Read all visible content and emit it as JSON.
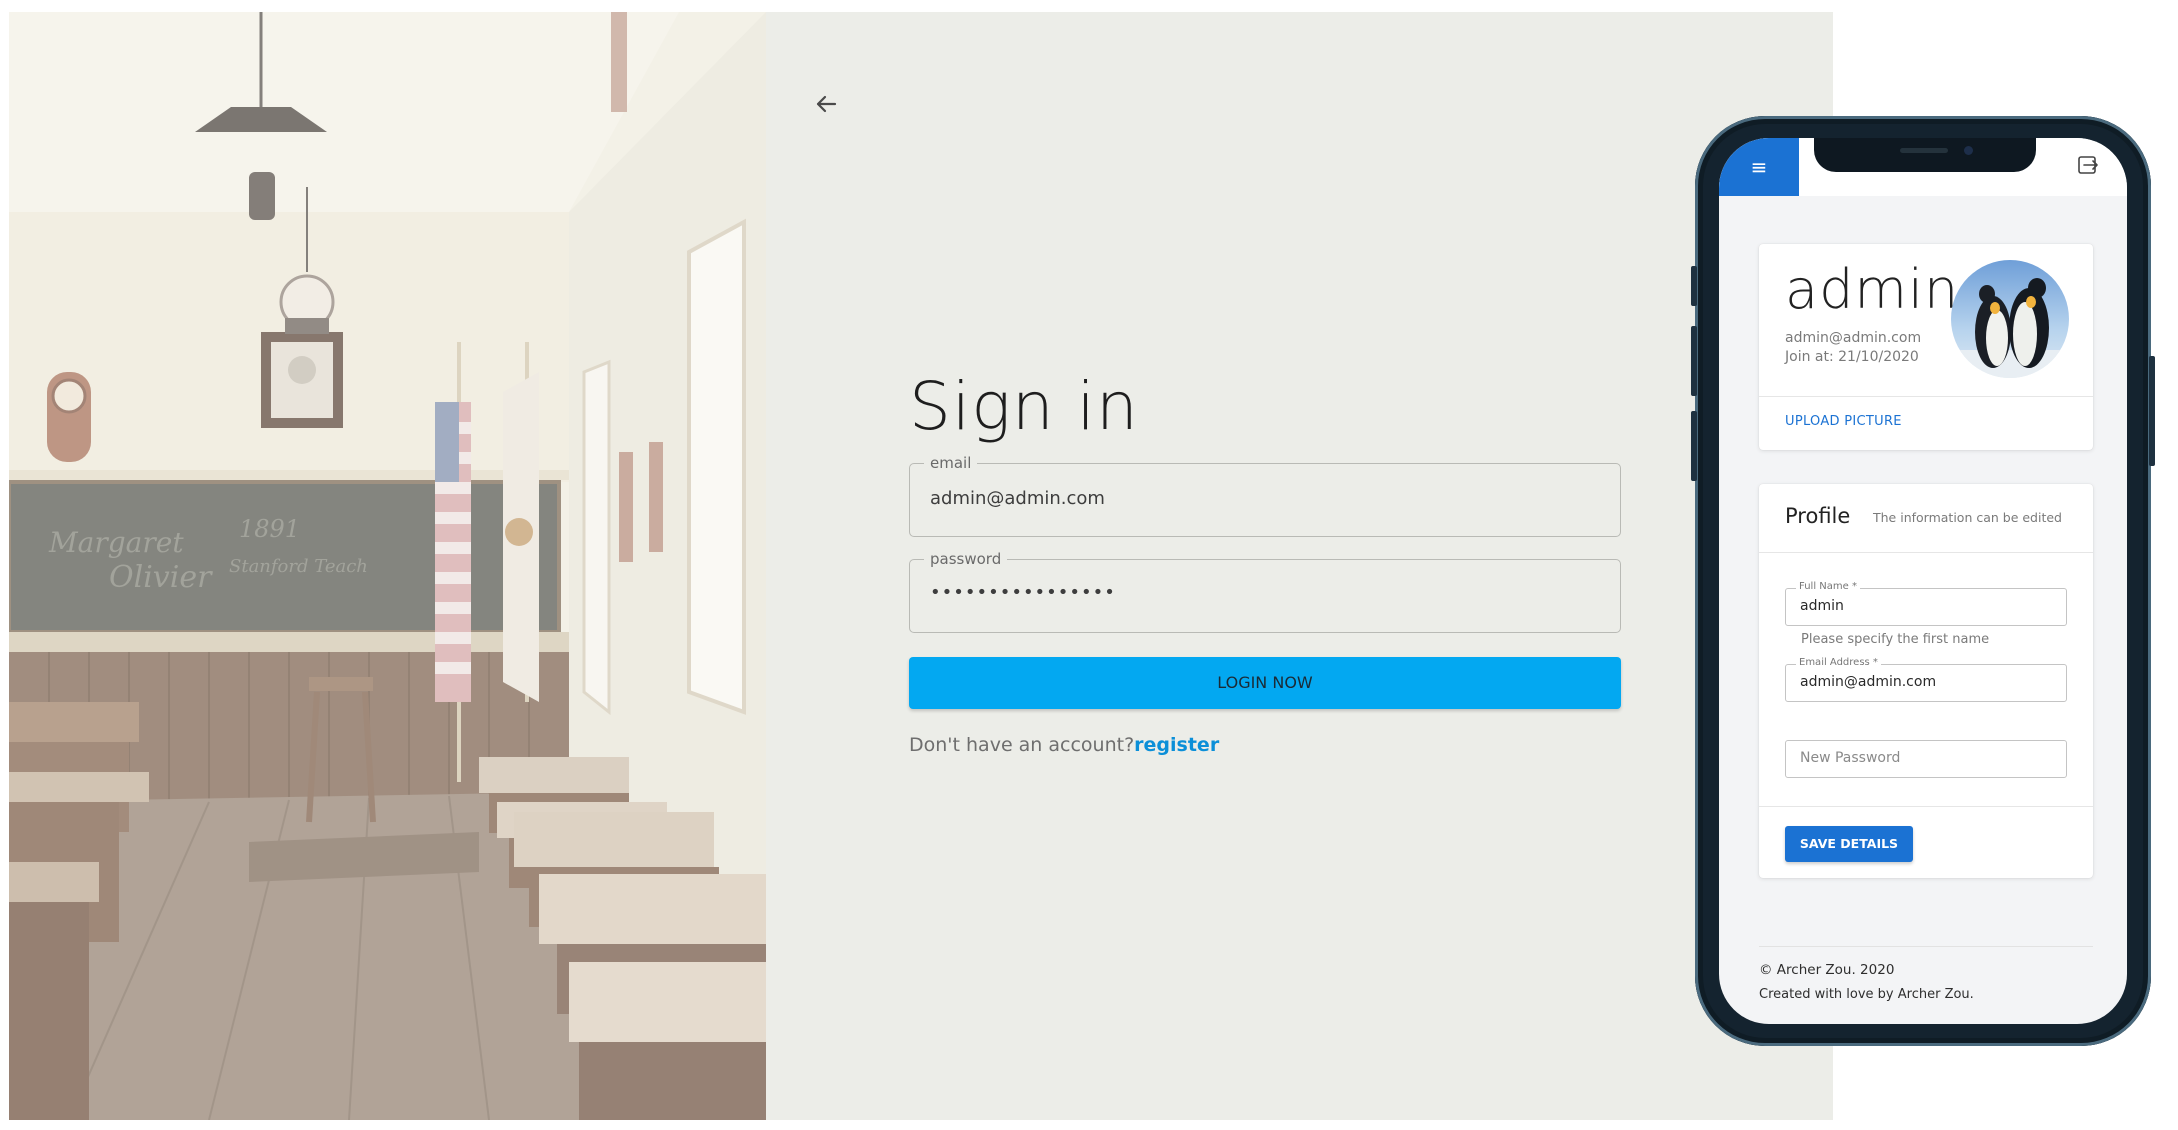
{
  "login_page": {
    "title": "Sign in",
    "email": {
      "label": "email",
      "value": "admin@admin.com"
    },
    "password": {
      "label": "password",
      "value": "••••••••••••••••"
    },
    "login_button_label": "LOGIN NOW",
    "register_prompt": "Don't have an account?",
    "register_link": "register",
    "back_icon": "arrow-left-icon"
  },
  "phone_app": {
    "app_bar": {
      "menu_icon": "menu-icon",
      "menu_glyph": "≡",
      "logout_icon": "logout-icon"
    },
    "account": {
      "name": "admin",
      "email": "admin@admin.com",
      "joined": "Join at: 21/10/2020",
      "upload_button_label": "UPLOAD PICTURE"
    },
    "profile": {
      "title": "Profile",
      "subtitle": "The information can be edited",
      "full_name": {
        "label": "Full Name *",
        "value": "admin",
        "helper": "Please specify the first name"
      },
      "email_address": {
        "label": "Email Address *",
        "value": "admin@admin.com"
      },
      "new_password": {
        "placeholder": "New Password"
      },
      "save_button_label": "SAVE DETAILS"
    },
    "footer": {
      "copyright": "© Archer Zou. 2020",
      "credit": "Created with love by Archer Zou."
    }
  },
  "colors": {
    "primary_button": "#03a8f1",
    "link": "#0b8fd8",
    "app_accent": "#1b72d3",
    "page_background": "#ecede8"
  }
}
